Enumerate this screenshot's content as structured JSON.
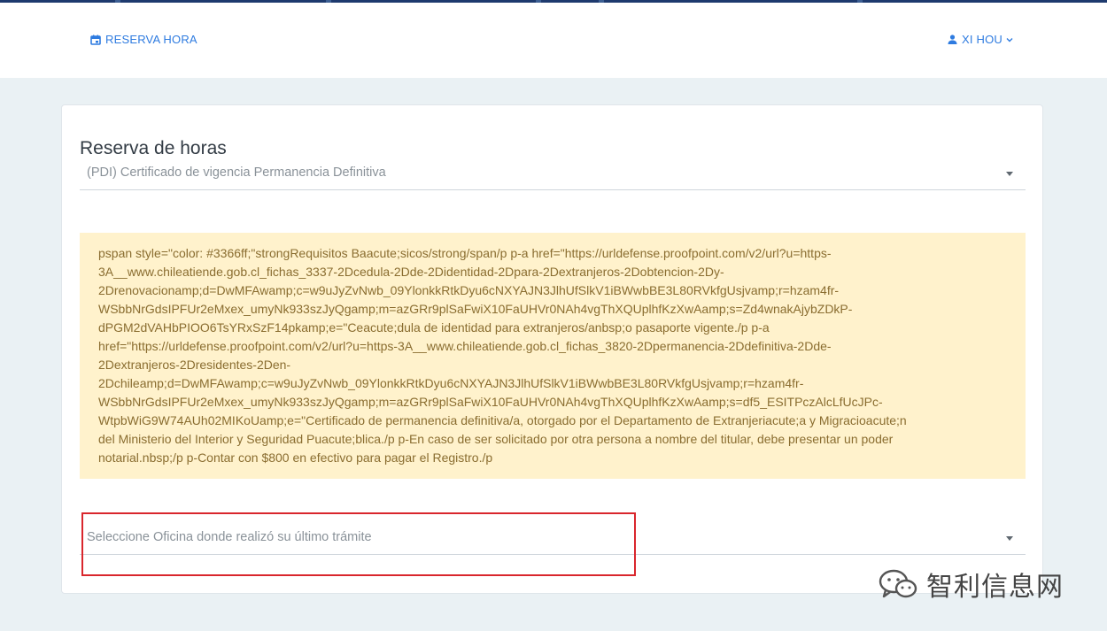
{
  "nav": {
    "reserva_label": "RESERVA HORA",
    "user_label": "XI HOU"
  },
  "card": {
    "title": "Reserva de horas",
    "tramite_select_value": "(PDI) Certificado de vigencia Permanencia Definitiva",
    "oficina_select_placeholder": "Seleccione Oficina donde realizó su último trámite"
  },
  "alert_lines": [
    "pspan style=\"color: #3366ff;\"strongRequisitos Baacute;sicos/strong/span/p p-a href=\"https://urldefense.proofpoint.com/v2/url?u=https-",
    "3A__www.chileatiende.gob.cl_fichas_3337-2Dcedula-2Dde-2Didentidad-2Dpara-2Dextranjeros-2Dobtencion-2Dy-",
    "2Drenovacionamp;d=DwMFAwamp;c=w9uJyZvNwb_09YlonkkRtkDyu6cNXYAJN3JlhUfSlkV1iBWwbBE3L80RVkfgUsjvamp;r=hzam4fr-",
    "WSbbNrGdsIPFUr2eMxex_umyNk933szJyQgamp;m=azGRr9plSaFwiX10FaUHVr0NAh4vgThXQUplhfKzXwAamp;s=Zd4wnakAjybZDkP-",
    "dPGM2dVAHbPIOO6TsYRxSzF14pkamp;e=\"Ceacute;dula de identidad para extranjeros/anbsp;o pasaporte vigente./p p-a",
    "href=\"https://urldefense.proofpoint.com/v2/url?u=https-3A__www.chileatiende.gob.cl_fichas_3820-2Dpermanencia-2Ddefinitiva-2Dde-",
    "2Dextranjeros-2Dresidentes-2Den-",
    "2Dchileamp;d=DwMFAwamp;c=w9uJyZvNwb_09YlonkkRtkDyu6cNXYAJN3JlhUfSlkV1iBWwbBE3L80RVkfgUsjvamp;r=hzam4fr-",
    "WSbbNrGdsIPFUr2eMxex_umyNk933szJyQgamp;m=azGRr9plSaFwiX10FaUHVr0NAh4vgThXQUplhfKzXwAamp;s=df5_ESITPczAlcLfUcJPc-",
    "WtpbWiG9W74AUh02MIKoUamp;e=\"Certificado de permanencia definitiva/a, otorgado por el Departamento de Extranjeriacute;a y Migracioacute;n",
    "del Ministerio del Interior y Seguridad Puacute;blica./p p-En caso de ser solicitado por otra persona a nombre del titular, debe presentar un poder",
    "notarial.nbsp;/p p-Contar con $800 en efectivo para pagar el Registro./p"
  ],
  "watermark": {
    "text": "智利信息网",
    "icon": "wechat-icon"
  },
  "colors": {
    "accent": "#2e7be0",
    "alert_bg": "#fff2cc",
    "alert_text": "#8a6d30",
    "highlight_border": "#d9262c",
    "page_bg": "#eaf1f4"
  }
}
